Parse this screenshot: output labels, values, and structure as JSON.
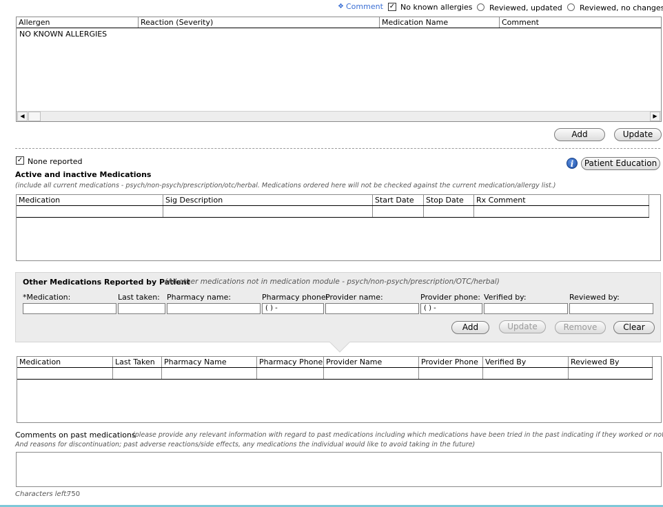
{
  "allergy_header": {
    "comment_link": "Comment",
    "comment_icon": "star-bullet-icon",
    "no_known_allergies": {
      "label": "No known allergies",
      "checked": true
    },
    "reviewed_updated": {
      "label": "Reviewed, updated",
      "selected": false
    },
    "reviewed_no_changes": {
      "label": "Reviewed, no changes",
      "selected": false
    }
  },
  "allergy_table": {
    "columns": [
      "Allergen",
      "Reaction (Severity)",
      "Medication Name",
      "Comment"
    ],
    "rows": [
      [
        "NO KNOWN ALLERGIES",
        "",
        "",
        ""
      ]
    ]
  },
  "allergy_buttons": {
    "add": "Add",
    "update": "Update"
  },
  "medications": {
    "none_reported": {
      "label": "None reported",
      "checked": true
    },
    "title": "Active and inactive Medications",
    "note": "(include all current medications - psych/non-psych/prescription/otc/herbal. Medications ordered here will not be checked against the current medication/allergy list.)",
    "patient_education": "Patient Education",
    "columns": [
      "Medication",
      "Sig Description",
      "Start Date",
      "Stop Date",
      "Rx Comment"
    ]
  },
  "other_meds": {
    "title": "Other Medications Reported by Patient",
    "note": "(All other medications not in medication module - psych/non-psych/prescription/OTC/herbal)",
    "fields": {
      "medication": "*Medication:",
      "last_taken": "Last taken:",
      "pharmacy_name": "Pharmacy name:",
      "pharmacy_phone": "Pharmacy phone:",
      "provider_name": "Provider name:",
      "provider_phone": "Provider phone:",
      "verified_by": "Verified by:",
      "reviewed_by": "Reviewed by:"
    },
    "phone_mask": "(  )  -",
    "buttons": {
      "add": "Add",
      "update": "Update",
      "remove": "Remove",
      "clear": "Clear"
    },
    "columns": [
      "Medication",
      "Last Taken",
      "Pharmacy Name",
      "Pharmacy Phone",
      "Provider Name",
      "Provider Phone",
      "Verified By",
      "Reviewed By"
    ]
  },
  "past_comments": {
    "label": "Comments on past medications",
    "note_line1": "(please provide any relevant information with regard to past medications including which medications have been tried in the past indicating if they worked or not)",
    "note_line2": "And reasons for discontinuation; past adverse reactions/side effects, any medications the individual would like to avoid taking in the future)",
    "chars_left_label": "Characters left:",
    "chars_left_value": "750"
  }
}
